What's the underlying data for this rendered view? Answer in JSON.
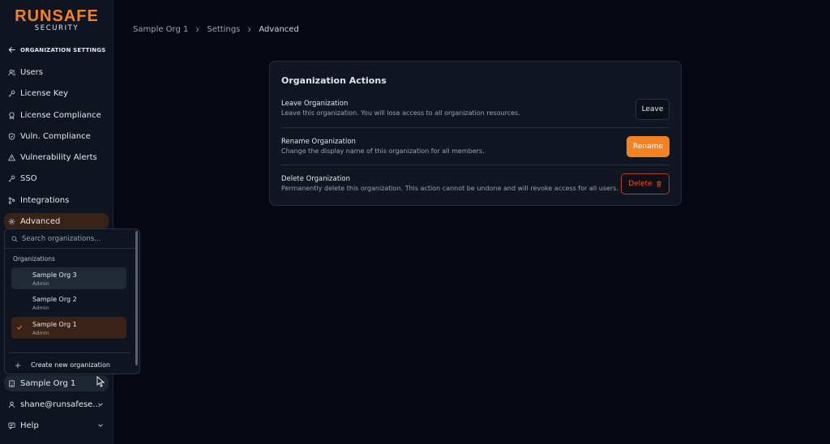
{
  "brand": {
    "name": "RUNSAFE",
    "tagline": "SECURITY",
    "accent": "#f58220"
  },
  "sidebar": {
    "back_label": "ORGANIZATION SETTINGS",
    "items": [
      {
        "label": "Users",
        "icon": "users-icon"
      },
      {
        "label": "License Key",
        "icon": "key-icon"
      },
      {
        "label": "License Compliance",
        "icon": "badge-icon"
      },
      {
        "label": "Vuln. Compliance",
        "icon": "shield-check-icon"
      },
      {
        "label": "Vulnerability Alerts",
        "icon": "alert-triangle-icon"
      },
      {
        "label": "SSO",
        "icon": "key-icon"
      },
      {
        "label": "Integrations",
        "icon": "git-branch-icon"
      },
      {
        "label": "Advanced",
        "icon": "gear-icon",
        "active": true
      }
    ],
    "org_switcher": "Sample Org 1",
    "user": "shane@runsafese...",
    "help": "Help"
  },
  "breadcrumb": [
    "Sample Org 1",
    "Settings",
    "Advanced"
  ],
  "card": {
    "title": "Organization Actions",
    "actions": [
      {
        "title": "Leave Organization",
        "description": "Leave this organization. You will lose access to all organization resources.",
        "button": "Leave"
      },
      {
        "title": "Rename Organization",
        "description": "Change the display name of this organization for all members.",
        "button": "Rename"
      },
      {
        "title": "Delete Organization",
        "description": "Permanently delete this organization. This action cannot be undone and will revoke access for all users.",
        "button": "Delete"
      }
    ]
  },
  "dropdown": {
    "search_placeholder": "Search organizations...",
    "heading": "Organizations",
    "orgs": [
      {
        "name": "Sample Org 3",
        "role": "Admin"
      },
      {
        "name": "Sample Org 2",
        "role": "Admin"
      },
      {
        "name": "Sample Org 1",
        "role": "Admin",
        "selected": true
      }
    ],
    "create_label": "Create new organization"
  }
}
